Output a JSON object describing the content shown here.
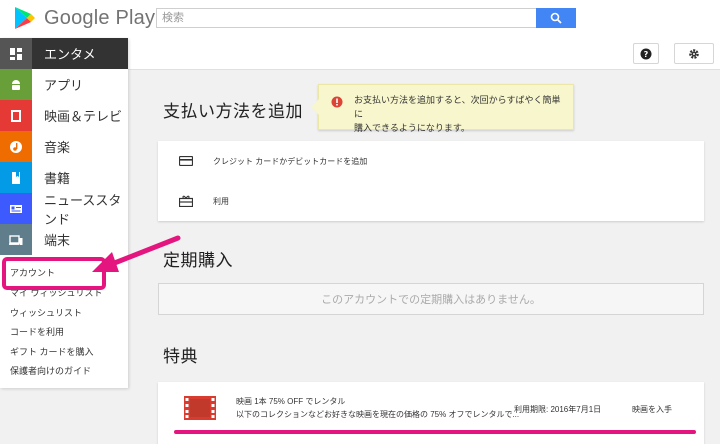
{
  "header": {
    "logo_text": "Google Play",
    "search_placeholder": "検索"
  },
  "sidebar": {
    "items": [
      {
        "label": "エンタメ",
        "icon": "apps-icon",
        "color": "#555555",
        "active": true
      },
      {
        "label": "アプリ",
        "icon": "android-icon",
        "color": "#689f38"
      },
      {
        "label": "映画＆テレビ",
        "icon": "film-icon",
        "color": "#e53935"
      },
      {
        "label": "音楽",
        "icon": "music-icon",
        "color": "#ef6c00"
      },
      {
        "label": "書籍",
        "icon": "book-icon",
        "color": "#039be5"
      },
      {
        "label": "ニューススタンド",
        "icon": "news-icon",
        "color": "#3d5afe"
      },
      {
        "label": "端末",
        "icon": "devices-icon",
        "color": "#607d8b"
      }
    ],
    "links": [
      "アカウント",
      "マイ ウィッシュリスト",
      "ウィッシュリスト",
      "コードを利用",
      "ギフト カードを購入",
      "保護者向けのガイド"
    ]
  },
  "tooltip": {
    "text_line1": "お支払い方法を追加すると、次回からすばやく簡単に",
    "text_line2": "購入できるようになります。"
  },
  "payment": {
    "title": "支払い方法を追加",
    "rows": [
      {
        "label": "クレジット カードかデビットカードを追加",
        "icon": "credit-card-icon"
      },
      {
        "label": "利用",
        "icon": "gift-card-icon"
      }
    ]
  },
  "subscriptions": {
    "title": "定期購入",
    "empty_text": "このアカウントでの定期購入はありません。"
  },
  "perks": {
    "title": "特典",
    "item": {
      "title": "映画 1本 75% OFF でレンタル",
      "description": "以下のコレクションなどお好きな映画を現在の価格の 75% オフでレンタルで...",
      "expiry": "利用期限: 2016年7月1日",
      "action": "映画を入手"
    }
  },
  "colors": {
    "accent": "#e4157f",
    "search": "#4285f4"
  }
}
